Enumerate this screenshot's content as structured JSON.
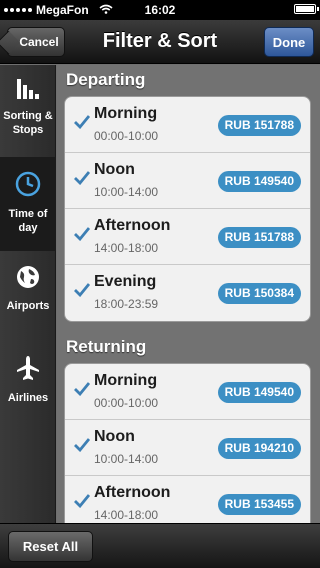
{
  "status_bar": {
    "carrier": "MegaFon",
    "time": "16:02"
  },
  "nav": {
    "title": "Filter & Sort",
    "cancel_label": "Cancel",
    "done_label": "Done"
  },
  "sidebar": {
    "items": [
      {
        "label": "Sorting &\nStops",
        "icon": "bar-chart-icon"
      },
      {
        "label": "Time of\nday",
        "icon": "clock-icon"
      },
      {
        "label": "Airports",
        "icon": "globe-icon"
      },
      {
        "label": "Airlines",
        "icon": "airplane-icon"
      }
    ]
  },
  "departing": {
    "header": "Departing",
    "rows": [
      {
        "title": "Morning",
        "range": "00:00-10:00",
        "price": "RUB 151788"
      },
      {
        "title": "Noon",
        "range": "10:00-14:00",
        "price": "RUB 149540"
      },
      {
        "title": "Afternoon",
        "range": "14:00-18:00",
        "price": "RUB 151788"
      },
      {
        "title": "Evening",
        "range": "18:00-23:59",
        "price": "RUB 150384"
      }
    ]
  },
  "returning": {
    "header": "Returning",
    "rows": [
      {
        "title": "Morning",
        "range": "00:00-10:00",
        "price": "RUB 149540"
      },
      {
        "title": "Noon",
        "range": "10:00-14:00",
        "price": "RUB 194210"
      },
      {
        "title": "Afternoon",
        "range": "14:00-18:00",
        "price": "RUB 153455"
      }
    ]
  },
  "toolbar": {
    "reset_label": "Reset All"
  },
  "colors": {
    "badge": "#3c8fc4",
    "checkmark": "#3d7fb4",
    "done_button": "#3d68ad"
  }
}
